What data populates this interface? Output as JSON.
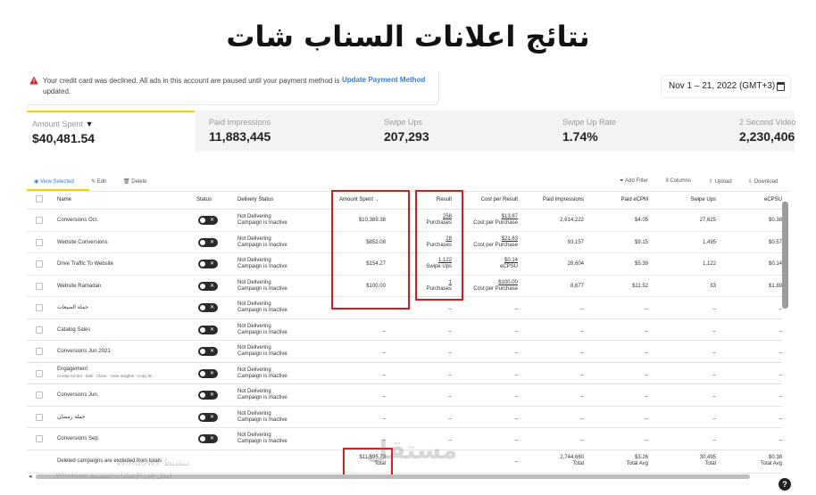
{
  "slide": {
    "title": "نتائج اعلانات السناب شات"
  },
  "alert": {
    "message": "Your credit card was declined. All ads in this account are paused until your payment method is updated.",
    "action_label": "Update Payment Method"
  },
  "date_range": {
    "label": "Nov 1 – 21, 2022 (GMT+3)"
  },
  "metrics": [
    {
      "label": "Amount Spent",
      "value": "$40,481.54"
    },
    {
      "label": "Paid Impressions",
      "value": "11,883,445"
    },
    {
      "label": "Swipe Ups",
      "value": "207,293"
    },
    {
      "label": "Swipe Up Rate",
      "value": "1.74%"
    },
    {
      "label": "2 Second Video",
      "value": "2,230,406"
    }
  ],
  "toolbar": {
    "view_selected": "View Selected",
    "edit": "Edit",
    "delete": "Delete",
    "add_filter": "Add Filter",
    "columns": "Columns",
    "upload": "Upload",
    "download": "Download"
  },
  "table": {
    "headers": {
      "name": "Name",
      "status": "Status",
      "delivery": "Delivery Status",
      "amount": "Amount Spent",
      "result": "Result",
      "cost_per_result": "Cost per Result",
      "paid_impressions": "Paid Impressions",
      "paid_ecpm": "Paid eCPM",
      "swipe_ups": "Swipe Ups",
      "ecpsu": "eCPSU"
    },
    "rows": [
      {
        "name": "Conversions Oct.",
        "sub": "",
        "delivery1": "Not Delivering",
        "delivery2": "Campaign is Inactive",
        "amount": "$10,389.38",
        "result": "258",
        "result_sub": "Purchases",
        "cpr": "$13.87",
        "cpr_sub": "Cost per Purchase",
        "impressions": "2,614,222",
        "ecpm": "$4.05",
        "swipe_ups": "27,625",
        "ecpsu": "$0.38"
      },
      {
        "name": "Website Conversions",
        "sub": "",
        "delivery1": "Not Delivering",
        "delivery2": "Campaign is Inactive",
        "amount": "$852.08",
        "result": "28",
        "result_sub": "Purchases",
        "cpr": "$21.63",
        "cpr_sub": "Cost per Purchase",
        "impressions": "93,157",
        "ecpm": "$9.15",
        "swipe_ups": "1,495",
        "ecpsu": "$0.57"
      },
      {
        "name": "Drive Traffic To Website",
        "sub": "",
        "delivery1": "Not Delivering",
        "delivery2": "Campaign is Inactive",
        "amount": "$154.27",
        "result": "1,122",
        "result_sub": "Swipe Ups",
        "cpr": "$0.14",
        "cpr_sub": "eCPSU",
        "impressions": "28,604",
        "ecpm": "$5.39",
        "swipe_ups": "1,122",
        "ecpsu": "$0.14"
      },
      {
        "name": "Website Ramadan",
        "sub": "",
        "delivery1": "Not Delivering",
        "delivery2": "Campaign is Inactive",
        "amount": "$100.00",
        "result": "1",
        "result_sub": "Purchases",
        "cpr": "$100.00",
        "cpr_sub": "Cost per Purchase",
        "impressions": "8,677",
        "ecpm": "$11.52",
        "swipe_ups": "53",
        "ecpsu": "$1.89"
      },
      {
        "name": "حملة المبيعات",
        "sub": "",
        "delivery1": "Not Delivering",
        "delivery2": "Campaign is Inactive",
        "amount": "–",
        "result": "–",
        "result_sub": "",
        "cpr": "–",
        "cpr_sub": "",
        "impressions": "–",
        "ecpm": "–",
        "swipe_ups": "–",
        "ecpsu": "–"
      },
      {
        "name": "Catalog Sales",
        "sub": "",
        "delivery1": "Not Delivering",
        "delivery2": "Campaign is Inactive",
        "amount": "–",
        "result": "–",
        "result_sub": "",
        "cpr": "–",
        "cpr_sub": "",
        "impressions": "–",
        "ecpm": "–",
        "swipe_ups": "–",
        "ecpsu": "–"
      },
      {
        "name": "Conversions Jun 2021",
        "sub": "",
        "delivery1": "Not Delivering",
        "delivery2": "Campaign is Inactive",
        "amount": "–",
        "result": "–",
        "result_sub": "",
        "cpr": "–",
        "cpr_sub": "",
        "impressions": "–",
        "ecpm": "–",
        "swipe_ups": "–",
        "ecpsu": "–"
      },
      {
        "name": "Engagement",
        "sub": "Create Ad Set · Edit · Clone · View Insights · Copy ID",
        "delivery1": "Not Delivering",
        "delivery2": "Campaign is Inactive",
        "amount": "–",
        "result": "–",
        "result_sub": "",
        "cpr": "–",
        "cpr_sub": "",
        "impressions": "–",
        "ecpm": "–",
        "swipe_ups": "–",
        "ecpsu": "–"
      },
      {
        "name": "Conversions Jun.",
        "sub": "",
        "delivery1": "Not Delivering",
        "delivery2": "Campaign is Inactive",
        "amount": "–",
        "result": "–",
        "result_sub": "",
        "cpr": "–",
        "cpr_sub": "",
        "impressions": "–",
        "ecpm": "–",
        "swipe_ups": "–",
        "ecpsu": "–"
      },
      {
        "name": "حملة رمضان",
        "sub": "",
        "delivery1": "Not Delivering",
        "delivery2": "Campaign is Inactive",
        "amount": "–",
        "result": "–",
        "result_sub": "",
        "cpr": "–",
        "cpr_sub": "",
        "impressions": "–",
        "ecpm": "–",
        "swipe_ups": "–",
        "ecpsu": "–"
      },
      {
        "name": "Conversions Sep.",
        "sub": "",
        "delivery1": "Not Delivering",
        "delivery2": "Campaign is Inactive",
        "amount": "–",
        "result": "–",
        "result_sub": "",
        "cpr": "–",
        "cpr_sub": "",
        "impressions": "–",
        "ecpm": "–",
        "swipe_ups": "–",
        "ecpsu": "–"
      }
    ],
    "footer": {
      "name": "Deleted campaigns are excluded from totals",
      "amount": "$11,595.73",
      "amount_sub": "Total",
      "cpr": "–",
      "impressions": "2,744,660",
      "impressions_sub": "Total",
      "ecpm": "$3.26",
      "ecpm_sub": "Total Avg",
      "swipe_ups": "30,495",
      "swipe_ups_sub": "Total",
      "ecpsu": "$0.38",
      "ecpsu_sub": "Total Avg"
    }
  },
  "overlay": {
    "windows_line1": "تنشيط Windows",
    "windows_line2": "انتقل إلى الإعدادات لتنشيط Windows.",
    "logo": "مستقل"
  },
  "colors": {
    "highlight": "#d11f1f",
    "accent_yellow": "#f5d000",
    "link_blue": "#2f7fd6"
  }
}
